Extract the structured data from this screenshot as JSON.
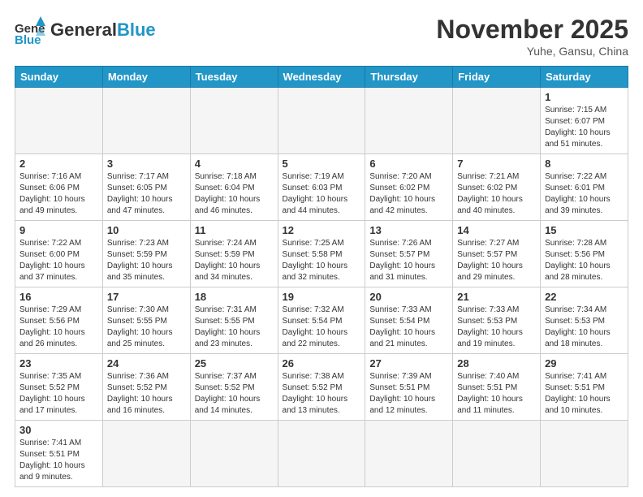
{
  "header": {
    "logo_general": "General",
    "logo_blue": "Blue",
    "month_title": "November 2025",
    "location": "Yuhe, Gansu, China"
  },
  "weekdays": [
    "Sunday",
    "Monday",
    "Tuesday",
    "Wednesday",
    "Thursday",
    "Friday",
    "Saturday"
  ],
  "weeks": [
    [
      {
        "day": "",
        "info": ""
      },
      {
        "day": "",
        "info": ""
      },
      {
        "day": "",
        "info": ""
      },
      {
        "day": "",
        "info": ""
      },
      {
        "day": "",
        "info": ""
      },
      {
        "day": "",
        "info": ""
      },
      {
        "day": "1",
        "info": "Sunrise: 7:15 AM\nSunset: 6:07 PM\nDaylight: 10 hours and 51 minutes."
      }
    ],
    [
      {
        "day": "2",
        "info": "Sunrise: 7:16 AM\nSunset: 6:06 PM\nDaylight: 10 hours and 49 minutes."
      },
      {
        "day": "3",
        "info": "Sunrise: 7:17 AM\nSunset: 6:05 PM\nDaylight: 10 hours and 47 minutes."
      },
      {
        "day": "4",
        "info": "Sunrise: 7:18 AM\nSunset: 6:04 PM\nDaylight: 10 hours and 46 minutes."
      },
      {
        "day": "5",
        "info": "Sunrise: 7:19 AM\nSunset: 6:03 PM\nDaylight: 10 hours and 44 minutes."
      },
      {
        "day": "6",
        "info": "Sunrise: 7:20 AM\nSunset: 6:02 PM\nDaylight: 10 hours and 42 minutes."
      },
      {
        "day": "7",
        "info": "Sunrise: 7:21 AM\nSunset: 6:02 PM\nDaylight: 10 hours and 40 minutes."
      },
      {
        "day": "8",
        "info": "Sunrise: 7:22 AM\nSunset: 6:01 PM\nDaylight: 10 hours and 39 minutes."
      }
    ],
    [
      {
        "day": "9",
        "info": "Sunrise: 7:22 AM\nSunset: 6:00 PM\nDaylight: 10 hours and 37 minutes."
      },
      {
        "day": "10",
        "info": "Sunrise: 7:23 AM\nSunset: 5:59 PM\nDaylight: 10 hours and 35 minutes."
      },
      {
        "day": "11",
        "info": "Sunrise: 7:24 AM\nSunset: 5:59 PM\nDaylight: 10 hours and 34 minutes."
      },
      {
        "day": "12",
        "info": "Sunrise: 7:25 AM\nSunset: 5:58 PM\nDaylight: 10 hours and 32 minutes."
      },
      {
        "day": "13",
        "info": "Sunrise: 7:26 AM\nSunset: 5:57 PM\nDaylight: 10 hours and 31 minutes."
      },
      {
        "day": "14",
        "info": "Sunrise: 7:27 AM\nSunset: 5:57 PM\nDaylight: 10 hours and 29 minutes."
      },
      {
        "day": "15",
        "info": "Sunrise: 7:28 AM\nSunset: 5:56 PM\nDaylight: 10 hours and 28 minutes."
      }
    ],
    [
      {
        "day": "16",
        "info": "Sunrise: 7:29 AM\nSunset: 5:56 PM\nDaylight: 10 hours and 26 minutes."
      },
      {
        "day": "17",
        "info": "Sunrise: 7:30 AM\nSunset: 5:55 PM\nDaylight: 10 hours and 25 minutes."
      },
      {
        "day": "18",
        "info": "Sunrise: 7:31 AM\nSunset: 5:55 PM\nDaylight: 10 hours and 23 minutes."
      },
      {
        "day": "19",
        "info": "Sunrise: 7:32 AM\nSunset: 5:54 PM\nDaylight: 10 hours and 22 minutes."
      },
      {
        "day": "20",
        "info": "Sunrise: 7:33 AM\nSunset: 5:54 PM\nDaylight: 10 hours and 21 minutes."
      },
      {
        "day": "21",
        "info": "Sunrise: 7:33 AM\nSunset: 5:53 PM\nDaylight: 10 hours and 19 minutes."
      },
      {
        "day": "22",
        "info": "Sunrise: 7:34 AM\nSunset: 5:53 PM\nDaylight: 10 hours and 18 minutes."
      }
    ],
    [
      {
        "day": "23",
        "info": "Sunrise: 7:35 AM\nSunset: 5:52 PM\nDaylight: 10 hours and 17 minutes."
      },
      {
        "day": "24",
        "info": "Sunrise: 7:36 AM\nSunset: 5:52 PM\nDaylight: 10 hours and 16 minutes."
      },
      {
        "day": "25",
        "info": "Sunrise: 7:37 AM\nSunset: 5:52 PM\nDaylight: 10 hours and 14 minutes."
      },
      {
        "day": "26",
        "info": "Sunrise: 7:38 AM\nSunset: 5:52 PM\nDaylight: 10 hours and 13 minutes."
      },
      {
        "day": "27",
        "info": "Sunrise: 7:39 AM\nSunset: 5:51 PM\nDaylight: 10 hours and 12 minutes."
      },
      {
        "day": "28",
        "info": "Sunrise: 7:40 AM\nSunset: 5:51 PM\nDaylight: 10 hours and 11 minutes."
      },
      {
        "day": "29",
        "info": "Sunrise: 7:41 AM\nSunset: 5:51 PM\nDaylight: 10 hours and 10 minutes."
      }
    ],
    [
      {
        "day": "30",
        "info": "Sunrise: 7:41 AM\nSunset: 5:51 PM\nDaylight: 10 hours and 9 minutes."
      },
      {
        "day": "",
        "info": ""
      },
      {
        "day": "",
        "info": ""
      },
      {
        "day": "",
        "info": ""
      },
      {
        "day": "",
        "info": ""
      },
      {
        "day": "",
        "info": ""
      },
      {
        "day": "",
        "info": ""
      }
    ]
  ]
}
